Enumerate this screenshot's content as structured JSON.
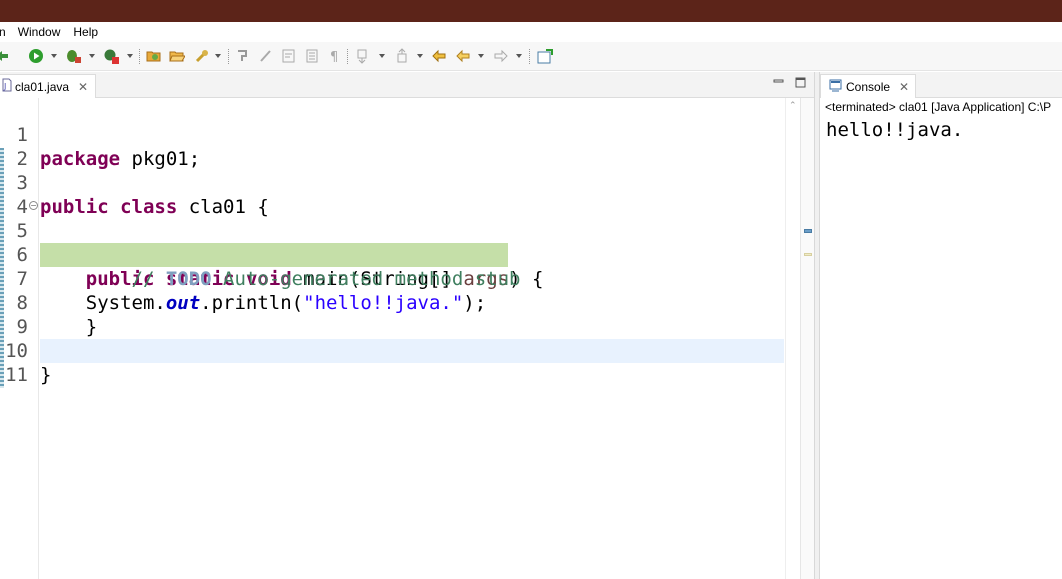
{
  "menu": [
    "n",
    "Window",
    "Help"
  ],
  "toolbar": {
    "icons": [
      "run-history-icon",
      "run-icon",
      "debug-icon",
      "external-tools-icon",
      "open-type-icon",
      "open-folder-icon",
      "search-icon",
      "toggle-mark-occurrences-icon",
      "toggle-breadcrumb-icon",
      "word-wrap-icon",
      "block-selection-icon",
      "show-whitespace-icon",
      "next-annotation-icon",
      "previous-annotation-icon",
      "back-icon",
      "forward-icon",
      "pin-editor-icon"
    ]
  },
  "editor": {
    "tab_label": "cla01.java",
    "lines": [
      {
        "n": "1"
      },
      {
        "n": "2"
      },
      {
        "n": "3"
      },
      {
        "n": "4"
      },
      {
        "n": "5"
      },
      {
        "n": "6"
      },
      {
        "n": "7"
      },
      {
        "n": "8"
      },
      {
        "n": "9"
      },
      {
        "n": "10"
      },
      {
        "n": "11"
      }
    ],
    "code": {
      "l1_kw": "package",
      "l1_rest": " pkg01;",
      "l3_kw1": "public",
      "l3_kw2": "class",
      "l3_rest": " cla01 {",
      "l5_kw1": "public",
      "l5_kw2": "static",
      "l5_kw3": "void",
      "l5_mid": " main(String[] ",
      "l5_param": "args",
      "l5_end": ") {",
      "l6_comment_start": "// ",
      "l6_todo": "TODO",
      "l6_comment_rest": " Auto-generated method stub",
      "l7_pre": "System.",
      "l7_field": "out",
      "l7_mid": ".println(",
      "l7_str": "\"hello!!java.\"",
      "l7_end": ");",
      "l8": "    }",
      "l10": "}"
    }
  },
  "console": {
    "tab_label": "Console",
    "header": "<terminated> cla01 [Java Application] C:\\P",
    "output": "hello!!java."
  },
  "colors": {
    "titlebar": "#5c2419",
    "keyword": "#7f0055",
    "comment": "#3f7f5f",
    "string": "#2a00ff",
    "field": "#0000c0",
    "selection": "#c5dfa8",
    "current_line": "#e8f2fe"
  }
}
